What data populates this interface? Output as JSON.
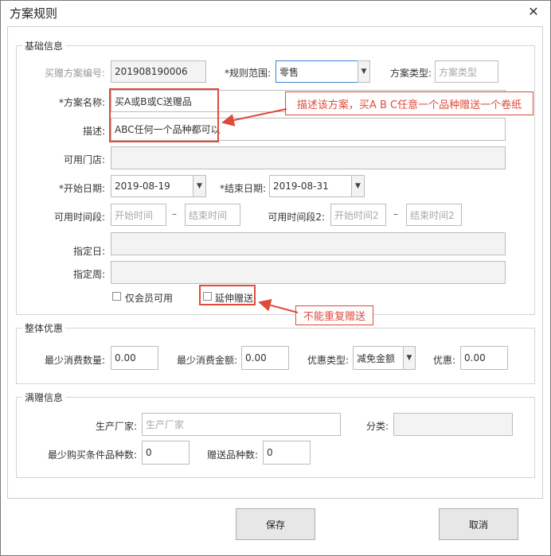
{
  "window": {
    "title": "方案规则",
    "close_glyph": "✕"
  },
  "basic": {
    "legend": "基础信息",
    "plan_no_label": "买赠方案编号:",
    "plan_no_value": "201908190006",
    "scope_label": "*规则范围:",
    "scope_value": "零售",
    "type_label": "方案类型:",
    "type_placeholder": "方案类型",
    "name_label": "*方案名称:",
    "name_value": "买A或B或C送赠品",
    "desc_label": "描述:",
    "desc_value": "ABC任何一个品种都可以",
    "stores_label": "可用门店:",
    "stores_value": "",
    "start_date_label": "*开始日期:",
    "start_date_value": "2019-08-19",
    "end_date_label": "*结束日期:",
    "end_date_value": "2019-08-31",
    "period1_label": "可用时间段:",
    "period1_start_ph": "开始时间",
    "period1_end_ph": "结束时间",
    "period2_label": "可用时间段2:",
    "period2_start_ph": "开始时间2",
    "period2_end_ph": "结束时间2",
    "dash": "–",
    "day_label": "指定日:",
    "day_value": "",
    "week_label": "指定周:",
    "week_value": "",
    "member_only_label": "仅会员可用",
    "extend_gift_label": "延伸赠送",
    "member_only_checked": false,
    "extend_gift_checked": false
  },
  "annotations": {
    "desc_callout": "描述该方案，买A B C任意一个品种赠送一个卷纸",
    "repeat_callout": "不能重复赠送"
  },
  "overall": {
    "legend": "整体优惠",
    "min_qty_label": "最少消费数量:",
    "min_qty_value": "0.00",
    "min_amount_label": "最少消费金额:",
    "min_amount_value": "0.00",
    "discount_type_label": "优惠类型:",
    "discount_type_value": "减免金额",
    "discount_label": "优惠:",
    "discount_value": "0.00"
  },
  "gift": {
    "legend": "满赠信息",
    "maker_label": "生产厂家:",
    "maker_placeholder": "生产厂家",
    "category_label": "分类:",
    "category_value": "",
    "min_kinds_label": "最少购买条件品种数:",
    "min_kinds_value": "0",
    "gift_kinds_label": "赠送品种数:",
    "gift_kinds_value": "0"
  },
  "footer": {
    "save_label": "保存",
    "cancel_label": "取消"
  },
  "colors": {
    "annotation_red": "#e04a3a"
  }
}
